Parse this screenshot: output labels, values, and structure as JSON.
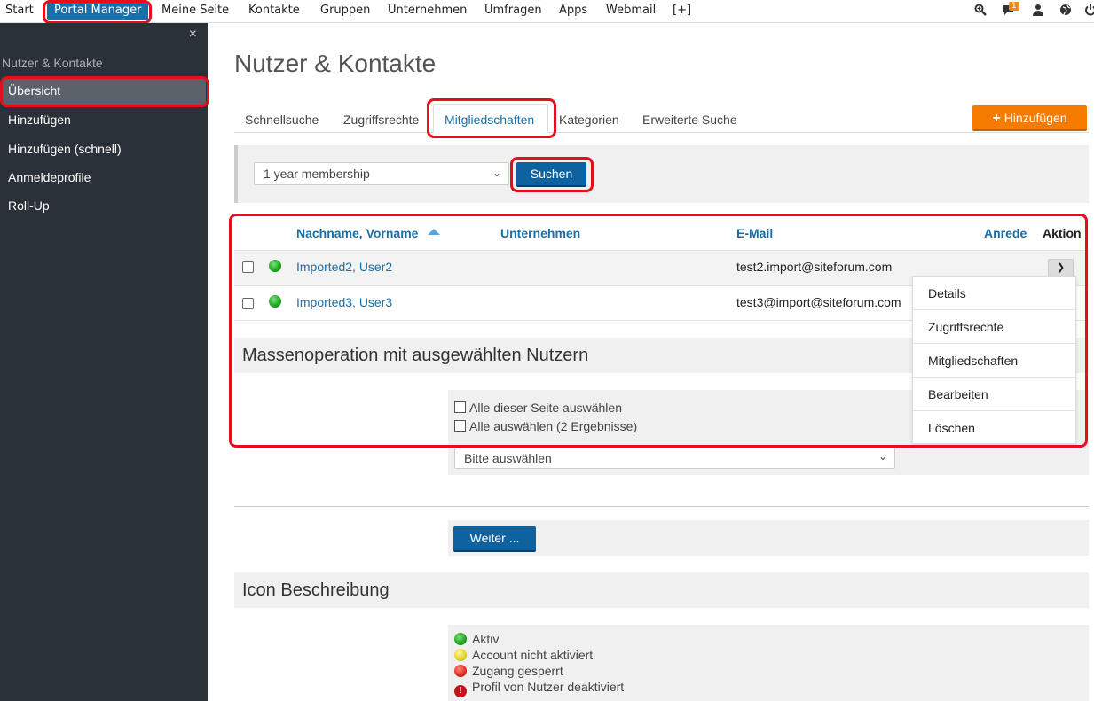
{
  "topnav": {
    "items": [
      "Start",
      "Portal Manager",
      "Meine Seite",
      "Kontakte",
      "Gruppen",
      "Unternehmen",
      "Umfragen",
      "Apps",
      "Webmail",
      "[+]"
    ],
    "notification_count": "1",
    "icons": [
      "search-icon",
      "chat-icon",
      "user-icon",
      "globe-icon",
      "power-icon"
    ]
  },
  "sidebar": {
    "close": "×",
    "title": "Nutzer & Kontakte",
    "items": [
      "Übersicht",
      "Hinzufügen",
      "Hinzufügen (schnell)",
      "Anmeldeprofile",
      "Roll-Up"
    ]
  },
  "main": {
    "title": "Nutzer & Kontakte",
    "tabs": [
      "Schnellsuche",
      "Zugriffsrechte",
      "Mitgliedschaften",
      "Kategorien",
      "Erweiterte Suche"
    ],
    "add_button": "Hinzufügen",
    "filter": {
      "selected": "1 year membership",
      "search_button": "Suchen"
    },
    "table": {
      "headers": {
        "name": "Nachname, Vorname",
        "company": "Unternehmen",
        "email": "E-Mail",
        "salutation": "Anrede",
        "action": "Aktion"
      },
      "rows": [
        {
          "name": "Imported2, User2",
          "email": "test2.import@siteforum.com",
          "status": "green"
        },
        {
          "name": "Imported3, User3",
          "email": "test3@import@siteforum.com",
          "status": "green"
        }
      ]
    },
    "action_menu": [
      "Details",
      "Zugriffsrechte",
      "Mitgliedschaften",
      "Bearbeiten",
      "Löschen"
    ],
    "mass": {
      "title": "Massenoperation mit ausgewählten Nutzern",
      "select_page": "Alle dieser Seite auswählen",
      "select_all": "Alle auswählen (2 Ergebnisse)",
      "operation_placeholder": "Bitte auswählen",
      "next_button": "Weiter ..."
    },
    "legend": {
      "title": "Icon Beschreibung",
      "items": [
        "Aktiv",
        "Account nicht aktiviert",
        "Zugang gesperrt",
        "Profil von Nutzer deaktiviert"
      ]
    }
  },
  "colors": {
    "accent": "#1a6fa8",
    "orange": "#f57c00",
    "highlight": "#e3101c",
    "sidebar": "#2b3138"
  }
}
